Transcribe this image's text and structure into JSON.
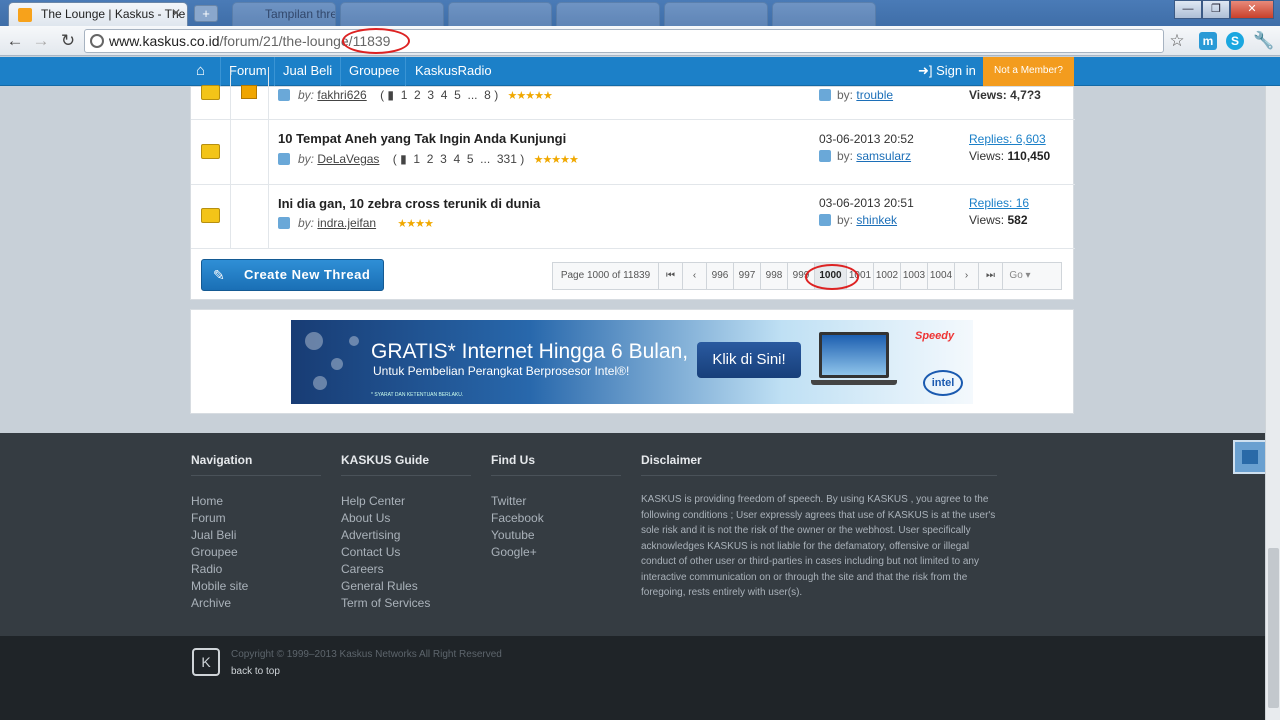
{
  "browser": {
    "active_tab_title": "The Lounge | Kaskus - The L",
    "background_tab_titles": [
      "Tampilan thread",
      "",
      "",
      "",
      "",
      ""
    ],
    "url_host": "www.kaskus.co.id",
    "url_path": "/forum/21/the-lounge/11839"
  },
  "site_nav": {
    "items": [
      "Forum",
      "Jual Beli",
      "Groupee",
      "KaskusRadio"
    ],
    "sign_in": "Sign in",
    "not_member": "Not a Member?"
  },
  "threads": [
    {
      "title": "",
      "author": "fakhri626",
      "pages": [
        "1",
        "2",
        "3",
        "4",
        "5",
        "...",
        "8"
      ],
      "stars": 5,
      "last_by": "trouble",
      "views": "Views: 4,7?3"
    },
    {
      "title": "10 Tempat Aneh yang Tak Ingin Anda Kunjungi",
      "author": "DeLaVegas",
      "pages": [
        "1",
        "2",
        "3",
        "4",
        "5",
        "...",
        "331"
      ],
      "stars": 5,
      "last_date": "03-06-2013 20:52",
      "last_by": "samsularz",
      "replies": "Replies: 6,603",
      "views_label": "Views: ",
      "views_value": "110,450"
    },
    {
      "title": "Ini dia gan, 10 zebra cross terunik di dunia",
      "author": "indra.jeifan",
      "stars": 4,
      "last_date": "03-06-2013 20:51",
      "last_by": "shinkek",
      "replies": "Replies: 16",
      "views_label": "Views: ",
      "views_value": "582"
    }
  ],
  "by_label": "by:",
  "create_thread": "Create New Thread",
  "pager": {
    "info": "Page 1000 of 11839",
    "first": "⏮",
    "prev": "‹",
    "pages": [
      "996",
      "997",
      "998",
      "999"
    ],
    "current": "1000",
    "pages_after": [
      "1001",
      "1002",
      "1003",
      "1004"
    ],
    "next": "›",
    "last": "⏭",
    "go": "Go ▾"
  },
  "banner": {
    "headline": "GRATIS* Internet Hingga 6 Bulan,",
    "subline": "Untuk Pembelian Perangkat Berprosesor Intel®!",
    "cta": "Klik di Sini!",
    "fineprint": "* SYARAT DAN KETENTUAN BERLAKU.",
    "brand1": "Speedy",
    "brand2": "intel"
  },
  "footer": {
    "navigation": {
      "title": "Navigation",
      "links": [
        "Home",
        "Forum",
        "Jual Beli",
        "Groupee",
        "Radio",
        "Mobile site",
        "Archive"
      ]
    },
    "guide": {
      "title": "KASKUS Guide",
      "links": [
        "Help Center",
        "About Us",
        "Advertising",
        "Contact Us",
        "Careers",
        "General Rules",
        "Term of Services"
      ]
    },
    "findus": {
      "title": "Find Us",
      "links": [
        "Twitter",
        "Facebook",
        "Youtube",
        "Google+"
      ]
    },
    "disclaimer": {
      "title": "Disclaimer",
      "text": "KASKUS is providing freedom of speech. By using KASKUS , you agree to the following conditions ; User expressly agrees that use of KASKUS is at the user's sole risk and it is not the risk of the owner or the webhost. User specifically acknowledges KASKUS is not liable for the defamatory, offensive or illegal conduct of other user or third-parties in cases including but not limited to any interactive communication on or through the site and that the risk from the foregoing, rests entirely with user(s)."
    },
    "copyright": "Copyright © 1999–2013 Kaskus Networks All Right Reserved",
    "back_to_top": "back to top"
  }
}
